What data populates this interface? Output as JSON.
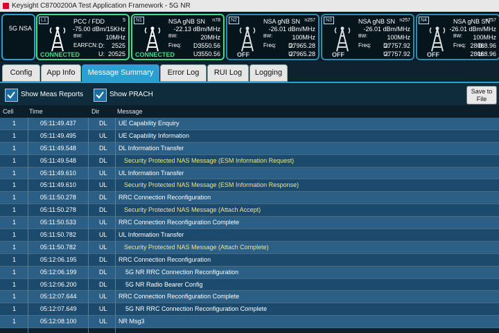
{
  "window": {
    "title": "Keysight C8700200A Test Application Framework - 5G NR"
  },
  "mode_label": "5G NSA",
  "cells": [
    {
      "num": "L1",
      "title": "PCC / FDD",
      "extra": "5",
      "power": "-75.00 dBm/15KHz",
      "bw_label": "BW:",
      "bw": "10MHz",
      "earfcn_label": "EARFCN:",
      "d_label": "D:",
      "d": "2525",
      "u_label": "U:",
      "u": "20525",
      "status": "CONNECTED"
    },
    {
      "num": "N1",
      "title": "NSA gNB SN",
      "extra": "n78",
      "power": "-22.13 dBm/MHz",
      "bw_label": "BW:",
      "bw": "20MHz",
      "freq_label": "Freq:",
      "d_label": "D:",
      "d": "3550.56",
      "u_label": "U:",
      "u": "3550.56",
      "status": "CONNECTED"
    },
    {
      "num": "N2",
      "title": "NSA gNB SN",
      "extra": "n257",
      "power": "-26.01 dBm/MHz",
      "bw_label": "BW:",
      "bw": "100MHz",
      "freq_label": "Freq:",
      "d_label": "D:",
      "d": "27965.28",
      "u_label": "U:",
      "u": "27965.28",
      "status": "OFF"
    },
    {
      "num": "N3",
      "title": "NSA gNB SN",
      "extra": "n257",
      "power": "-26.01 dBm/MHz",
      "bw_label": "BW:",
      "bw": "100MHz",
      "freq_label": "Freq:",
      "d_label": "D:",
      "d": "27757.92",
      "u_label": "U:",
      "u": "27757.92",
      "status": "OFF"
    },
    {
      "num": "N4",
      "title": "NSA gNB SN",
      "extra": "n257",
      "power": "-26.01 dBm/MHz",
      "bw_label": "BW:",
      "bw": "100MHz",
      "freq_label": "Freq:",
      "d_label": "D:",
      "d": "28068.96",
      "u_label": "U:",
      "u": "28068.96",
      "status": "OFF"
    }
  ],
  "tabs": [
    "Config",
    "App Info",
    "Message Summary",
    "Error Log",
    "RUI Log",
    "Logging"
  ],
  "toolbar": {
    "show_meas": "Show Meas Reports",
    "show_prach": "Show PRACH",
    "save_line1": "Save to",
    "save_line2": "File"
  },
  "columns": {
    "cell": "Cell",
    "time": "Time",
    "dir": "Dir",
    "message": "Message"
  },
  "rows": [
    {
      "cell": "1",
      "time": "05:11:49.437",
      "dir": "DL",
      "message": "UE Capability Enquiry",
      "kind": ""
    },
    {
      "cell": "1",
      "time": "05:11:49.495",
      "dir": "UL",
      "message": "UE Capability Information",
      "kind": ""
    },
    {
      "cell": "1",
      "time": "05:11:49.548",
      "dir": "DL",
      "message": "DL Information Transfer",
      "kind": ""
    },
    {
      "cell": "1",
      "time": "05:11:49.548",
      "dir": "DL",
      "message": "Security Protected NAS Message (ESM Information Request)",
      "kind": "nas"
    },
    {
      "cell": "1",
      "time": "05:11:49.610",
      "dir": "UL",
      "message": "UL Information Transfer",
      "kind": ""
    },
    {
      "cell": "1",
      "time": "05:11:49.610",
      "dir": "UL",
      "message": "Security Protected NAS Message (ESM Information Response)",
      "kind": "nas"
    },
    {
      "cell": "1",
      "time": "05:11:50.278",
      "dir": "DL",
      "message": "RRC Connection Reconfiguration",
      "kind": ""
    },
    {
      "cell": "1",
      "time": "05:11:50.278",
      "dir": "DL",
      "message": "Security Protected NAS Message (Attach Accept)",
      "kind": "nas"
    },
    {
      "cell": "1",
      "time": "05:11:50.533",
      "dir": "UL",
      "message": "RRC Connection Reconfiguration Complete",
      "kind": ""
    },
    {
      "cell": "1",
      "time": "05:11:50.782",
      "dir": "UL",
      "message": "UL Information Transfer",
      "kind": ""
    },
    {
      "cell": "1",
      "time": "05:11:50.782",
      "dir": "UL",
      "message": "Security Protected NAS Message (Attach Complete)",
      "kind": "nas"
    },
    {
      "cell": "1",
      "time": "05:12:06.195",
      "dir": "DL",
      "message": "RRC Connection Reconfiguration",
      "kind": ""
    },
    {
      "cell": "1",
      "time": "05:12:06.199",
      "dir": "DL",
      "message": "5G NR RRC Connection Reconfiguration",
      "kind": "sub"
    },
    {
      "cell": "1",
      "time": "05:12:06.200",
      "dir": "DL",
      "message": "5G NR Radio Bearer Config",
      "kind": "sub"
    },
    {
      "cell": "1",
      "time": "05:12:07.644",
      "dir": "UL",
      "message": "RRC Connection Reconfiguration Complete",
      "kind": ""
    },
    {
      "cell": "1",
      "time": "05:12:07.649",
      "dir": "UL",
      "message": "5G NR RRC Connection Reconfiguration Complete",
      "kind": "sub"
    },
    {
      "cell": "1",
      "time": "05:12:08.100",
      "dir": "UL",
      "message": "NR Msg3",
      "kind": ""
    }
  ],
  "icons": {
    "app": "keysight-logo-icon",
    "check": "checkmark-icon",
    "tower": "antenna-tower-icon"
  },
  "colors": {
    "accent": "#2a9fd0",
    "connected": "#3fe08a",
    "nas_text": "#f0e68c"
  }
}
